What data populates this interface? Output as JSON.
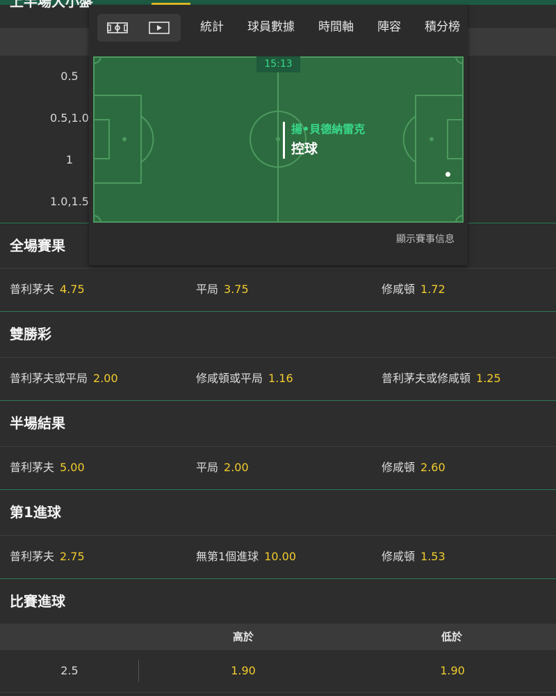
{
  "clipped_heading": "上半場大小盤",
  "half_time_lines": [
    "0.5",
    "0.5,1.0",
    "1",
    "1.0,1.5"
  ],
  "overlay": {
    "icons": [
      "pitch-view-icon",
      "play-video-icon"
    ],
    "tabs": [
      "統計",
      "球員數據",
      "時間軸",
      "陣容",
      "積分榜"
    ],
    "clock": "15:13",
    "team_name": "揚•貝德納雷克",
    "event_text": "控球",
    "show_info": "顯示賽事信息",
    "pitch_color": "#2c6b3f"
  },
  "markets": {
    "full_time": {
      "title": "全場賽果",
      "options": [
        {
          "name": "普利茅夫",
          "odd": "4.75"
        },
        {
          "name": "平局",
          "odd": "3.75"
        },
        {
          "name": "修咸頓",
          "odd": "1.72"
        }
      ]
    },
    "double_chance": {
      "title": "雙勝彩",
      "options": [
        {
          "name": "普利茅夫或平局",
          "odd": "2.00"
        },
        {
          "name": "修咸頓或平局",
          "odd": "1.16"
        },
        {
          "name": "普利茅夫或修咸頓",
          "odd": "1.25"
        }
      ]
    },
    "half_time": {
      "title": "半場結果",
      "options": [
        {
          "name": "普利茅夫",
          "odd": "5.00"
        },
        {
          "name": "平局",
          "odd": "2.00"
        },
        {
          "name": "修咸頓",
          "odd": "2.60"
        }
      ]
    },
    "first_goal": {
      "title": "第1進球",
      "options": [
        {
          "name": "普利茅夫",
          "odd": "2.75"
        },
        {
          "name": "無第1個進球",
          "odd": "10.00"
        },
        {
          "name": "修咸頓",
          "odd": "1.53"
        }
      ]
    },
    "match_goals": {
      "title": "比賽進球",
      "over_label": "高於",
      "under_label": "低於",
      "line": "2.5",
      "over": "1.90",
      "under": "1.90"
    }
  },
  "colors": {
    "accent": "#e6c229",
    "odds": "#f2cc2e",
    "team": "#39d98a",
    "background": "#2d2d2d"
  }
}
